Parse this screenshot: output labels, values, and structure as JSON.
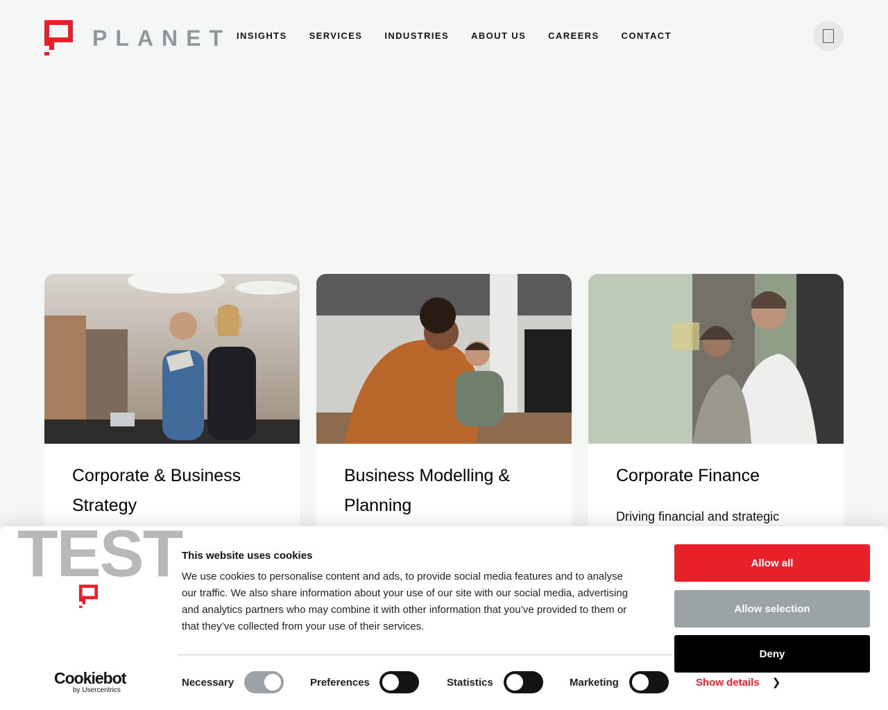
{
  "brand": {
    "name": "PLANET",
    "accent": "#e8202a",
    "grey": "#8f989c"
  },
  "nav": {
    "items": [
      {
        "label": "INSIGHTS"
      },
      {
        "label": "SERVICES"
      },
      {
        "label": "INDUSTRIES"
      },
      {
        "label": "ABOUT US"
      },
      {
        "label": "CAREERS"
      },
      {
        "label": "CONTACT"
      }
    ],
    "menu_icon": "menu-icon"
  },
  "cards": [
    {
      "title": "Corporate & Business Strategy",
      "description": "",
      "image": "office-team-photo"
    },
    {
      "title": "Business Modelling & Planning",
      "description": "",
      "image": "collaborating-at-desk-photo"
    },
    {
      "title": "Corporate Finance",
      "description": "Driving financial and strategic",
      "image": "glass-wall-planning-photo"
    }
  ],
  "cookie_banner": {
    "badge": "TEST",
    "title": "This website uses cookies",
    "text": "We use cookies to personalise content and ads, to provide social media features and to analyse our traffic. We also share information about your use of our site with our social media, advertising and analytics partners who may combine it with other information that you’ve provided to them or that they’ve collected from your use of their services.",
    "buttons": {
      "allow_all": "Allow all",
      "allow_selection": "Allow selection",
      "deny": "Deny"
    },
    "provider": {
      "name": "Cookiebot",
      "subtitle": "by Usercentrics"
    },
    "toggles": [
      {
        "label": "Necessary",
        "state": "on-disabled"
      },
      {
        "label": "Preferences",
        "state": "off"
      },
      {
        "label": "Statistics",
        "state": "off"
      },
      {
        "label": "Marketing",
        "state": "off"
      }
    ],
    "show_details": "Show details"
  }
}
